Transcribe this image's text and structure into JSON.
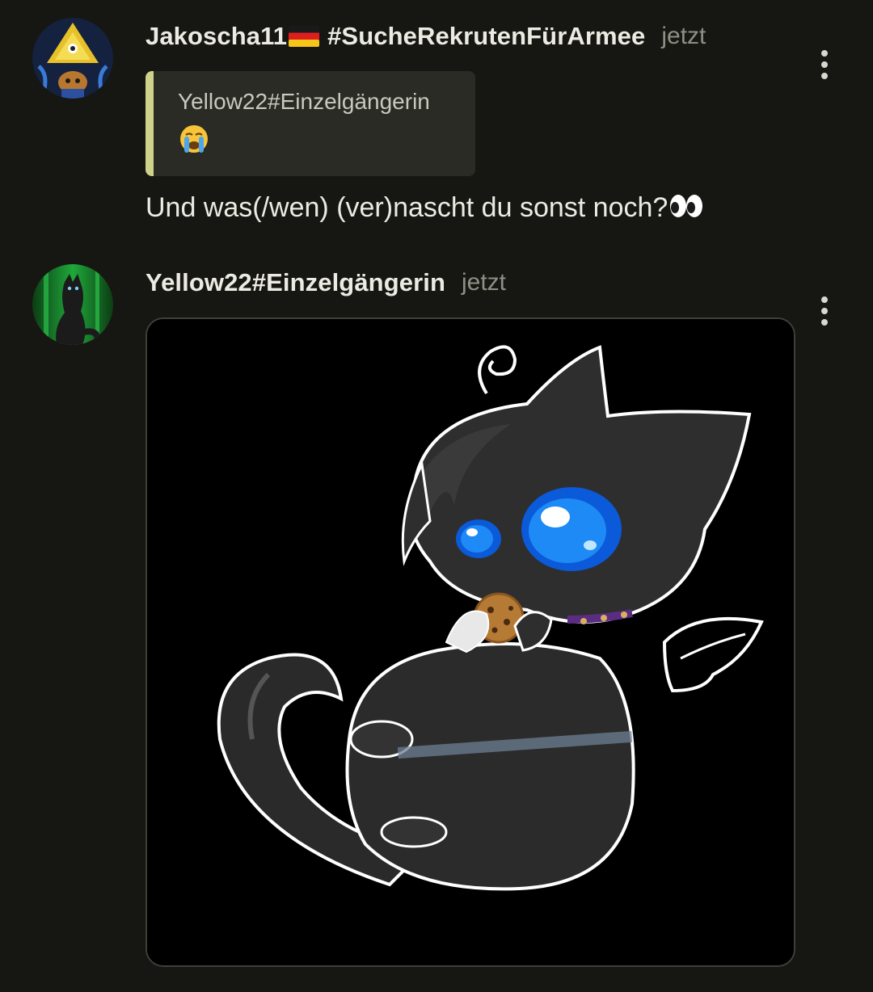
{
  "messages": [
    {
      "author": "Jakoscha11",
      "author_suffix": "#SucheRekrutenFürArmee",
      "time": "jetzt",
      "quote": {
        "author": "Yellow22#Einzelgängerin",
        "emoji": "😭"
      },
      "text": "Und was(/wen) (ver)nascht du sonst noch?",
      "text_emoji": "👀"
    },
    {
      "author": "Yellow22#Einzelgängerin",
      "time": "jetzt",
      "image_alt": "black chibi cat with blue eyes eating a cookie"
    }
  ],
  "icons": {
    "flag": "germany-flag-icon",
    "menu": "more-vertical-icon"
  },
  "colors": {
    "background": "#161712",
    "quote_accent": "#cfd28a",
    "quote_bg": "#2a2b25",
    "time": "#8f8f86"
  }
}
